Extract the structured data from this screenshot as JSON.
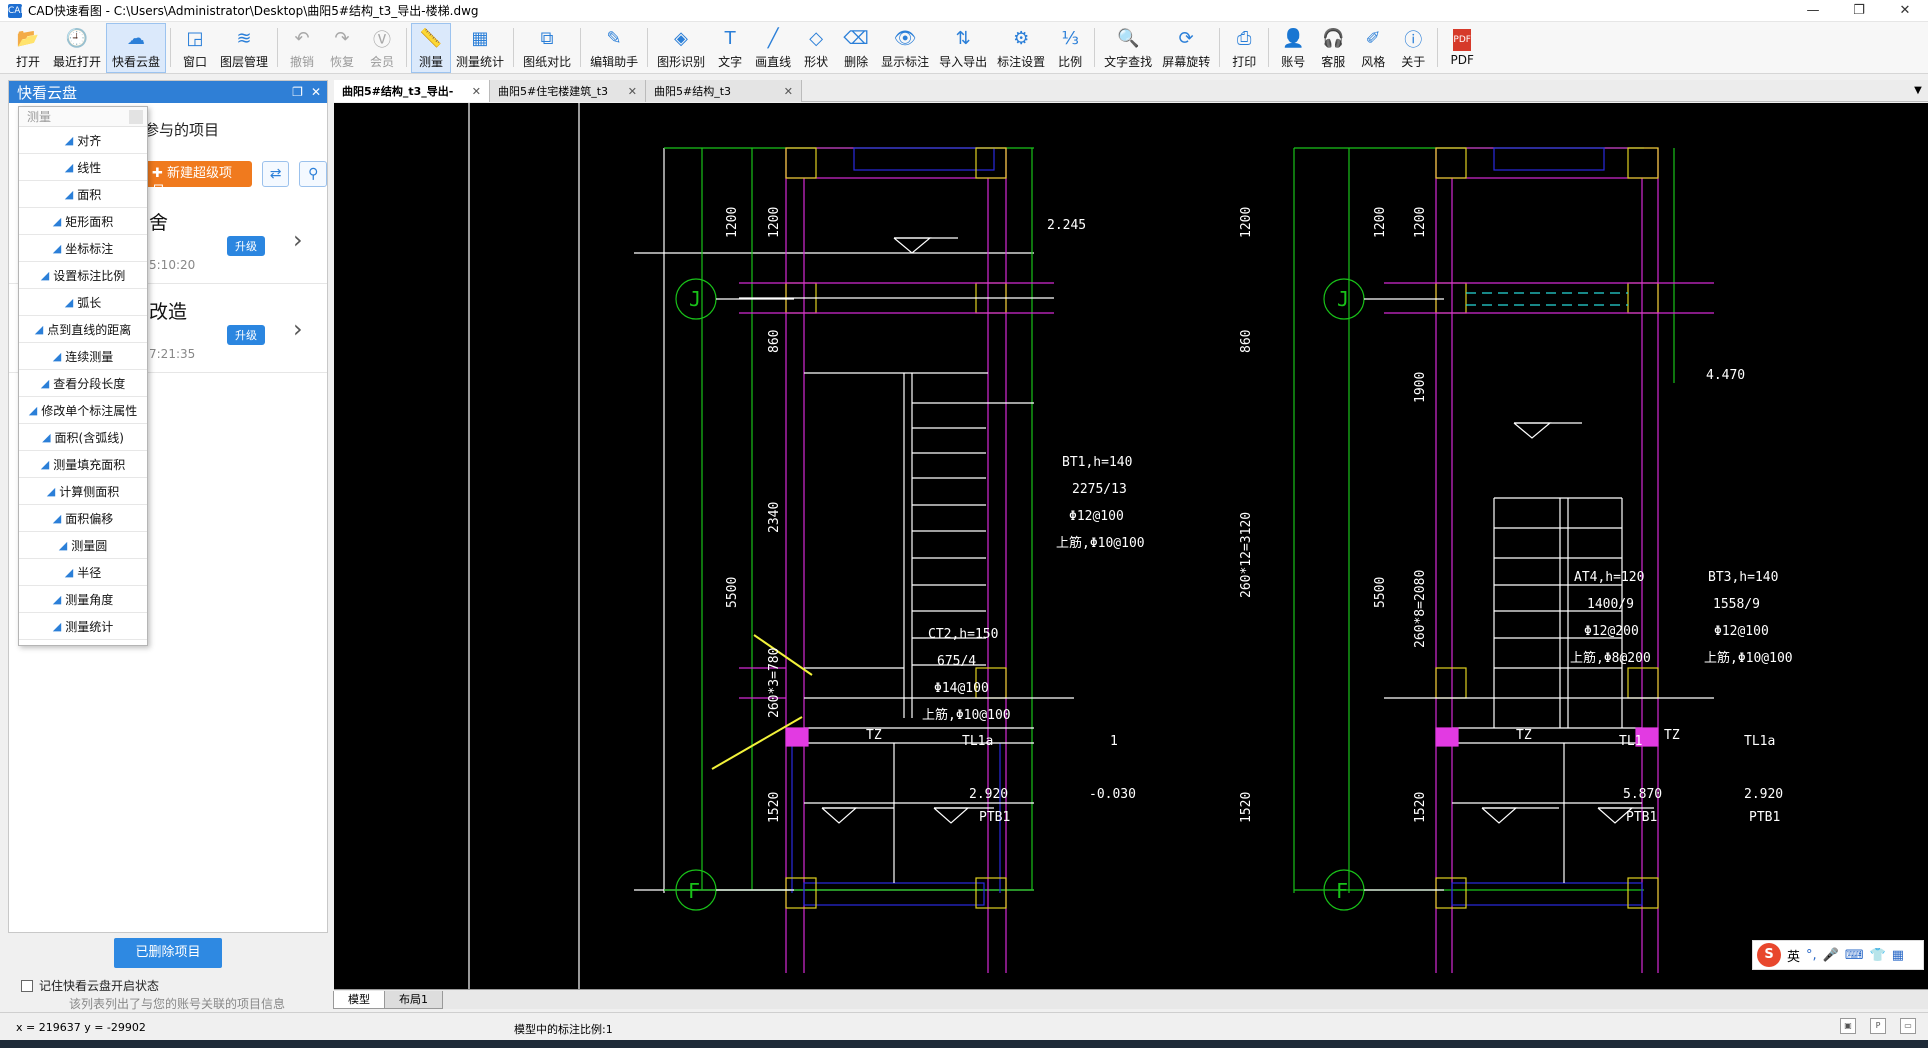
{
  "window": {
    "title": "CAD快速看图 - C:\\Users\\Administrator\\Desktop\\曲阳5#结构_t3_导出-楼梯.dwg",
    "app_icon": "CAD"
  },
  "toolbar": [
    {
      "label": "打开",
      "icon": "folder-open-icon",
      "glyph": "📂"
    },
    {
      "label": "最近打开",
      "icon": "recent-icon",
      "glyph": "🕘"
    },
    {
      "label": "快看云盘",
      "icon": "cloud-icon",
      "glyph": "☁",
      "active": true
    },
    {
      "label": "窗口",
      "icon": "window-icon",
      "glyph": "◲"
    },
    {
      "label": "图层管理",
      "icon": "layers-icon",
      "glyph": "≋"
    },
    {
      "label": "撤销",
      "icon": "undo-icon",
      "glyph": "↶",
      "dim": true
    },
    {
      "label": "恢复",
      "icon": "redo-icon",
      "glyph": "↷",
      "dim": true
    },
    {
      "label": "会员",
      "icon": "vip-icon",
      "glyph": "Ⓥ",
      "dim": true
    },
    {
      "label": "测量",
      "icon": "measure-icon",
      "glyph": "📏",
      "active": true
    },
    {
      "label": "测量统计",
      "icon": "measure-stats-icon",
      "glyph": "▦"
    },
    {
      "label": "图纸对比",
      "icon": "compare-icon",
      "glyph": "⧉"
    },
    {
      "label": "编辑助手",
      "icon": "edit-assistant-icon",
      "glyph": "✎"
    },
    {
      "label": "图形识别",
      "icon": "shape-recognize-icon",
      "glyph": "◈"
    },
    {
      "label": "文字",
      "icon": "text-icon",
      "glyph": "T"
    },
    {
      "label": "画直线",
      "icon": "line-icon",
      "glyph": "╱"
    },
    {
      "label": "形状",
      "icon": "shape-icon",
      "glyph": "◇"
    },
    {
      "label": "删除",
      "icon": "eraser-icon",
      "glyph": "⌫"
    },
    {
      "label": "显示标注",
      "icon": "eye-icon",
      "glyph": "👁"
    },
    {
      "label": "导入导出",
      "icon": "import-export-icon",
      "glyph": "⇅"
    },
    {
      "label": "标注设置",
      "icon": "annotation-settings-icon",
      "glyph": "⚙"
    },
    {
      "label": "比例",
      "icon": "scale-icon",
      "glyph": "⅓"
    },
    {
      "label": "文字查找",
      "icon": "text-search-icon",
      "glyph": "🔍"
    },
    {
      "label": "屏幕旋转",
      "icon": "rotate-screen-icon",
      "glyph": "⟳"
    },
    {
      "label": "打印",
      "icon": "printer-icon",
      "glyph": "⎙"
    },
    {
      "label": "账号",
      "icon": "user-icon",
      "glyph": "👤"
    },
    {
      "label": "客服",
      "icon": "headset-icon",
      "glyph": "🎧"
    },
    {
      "label": "风格",
      "icon": "style-icon",
      "glyph": "✐"
    },
    {
      "label": "关于",
      "icon": "info-icon",
      "glyph": "ⓘ"
    },
    {
      "label": "PDF",
      "icon": "pdf-icon",
      "glyph": "PDF"
    }
  ],
  "left_panel": {
    "title": "快看云盘",
    "subtitle": "参与的项目",
    "new_project_label": "新建超级项目",
    "projects": [
      {
        "name": "舍",
        "time": "5:10:20",
        "upgrade": "升级"
      },
      {
        "name": "改造",
        "time": "7:21:35",
        "upgrade": "升级"
      }
    ],
    "deleted_button": "已删除项目",
    "remember_label": "记住快看云盘开启状态",
    "note": "该列表列出了与您的账号关联的项目信息"
  },
  "measure_menu": {
    "title": "测量",
    "items": [
      "对齐",
      "线性",
      "面积",
      "矩形面积",
      "坐标标注",
      "设置标注比例",
      "弧长",
      "点到直线的距离",
      "连续测量",
      "查看分段长度",
      "修改单个标注属性",
      "面积(含弧线)",
      "测量填充面积",
      "计算侧面积",
      "面积偏移",
      "测量圆",
      "半径",
      "测量角度",
      "测量统计"
    ]
  },
  "doc_tabs": [
    {
      "label": "曲阳5#结构_t3_导出-",
      "active": true
    },
    {
      "label": "曲阳5#住宅楼建筑_t3",
      "active": false
    },
    {
      "label": "曲阳5#结构_t3",
      "active": false
    }
  ],
  "layout_tabs": [
    "模型",
    "布局1"
  ],
  "status": {
    "coords": "x = 219637  y = -29902",
    "scale_text": "模型中的标注比例:1"
  },
  "drawing": {
    "axis_j": "J",
    "axis_f": "F",
    "left": {
      "dims": [
        "1200",
        "1200",
        "860",
        "2340",
        "5500",
        "260*3=780",
        "1520",
        "1200",
        "860",
        "260*12=3120",
        "1520"
      ],
      "level_top": "2.245",
      "stair_a": [
        "BT1,h=140",
        "2275/13",
        "Φ12@100",
        "上筋,Φ10@100"
      ],
      "stair_b": [
        "CT2,h=150",
        "675/4",
        "Φ14@100",
        "上筋,Φ10@100"
      ],
      "tz": "TZ",
      "tl": "TL1a",
      "mark": "1",
      "level_1": "2.920",
      "level_2": "-0.030",
      "ptb": "PTB1"
    },
    "right": {
      "dims": [
        "1200",
        "1200",
        "1900",
        "5500",
        "260*8=2080",
        "1520"
      ],
      "level_top": "4.470",
      "stair_a": [
        "AT4,h=120",
        "1400/9",
        "Φ12@200",
        "上筋,Φ8@200"
      ],
      "stair_b": [
        "BT3,h=140",
        "1558/9",
        "Φ12@100",
        "上筋,Φ10@100"
      ],
      "tz_left": "TZ",
      "tz_right": "TZ",
      "tl_a": "TL1",
      "tl_b": "TL1a",
      "level_1": "5.870",
      "level_2": "2.920",
      "ptb_a": "PTB1",
      "ptb_b": "PTB1"
    }
  },
  "ime": {
    "lang": "英"
  }
}
